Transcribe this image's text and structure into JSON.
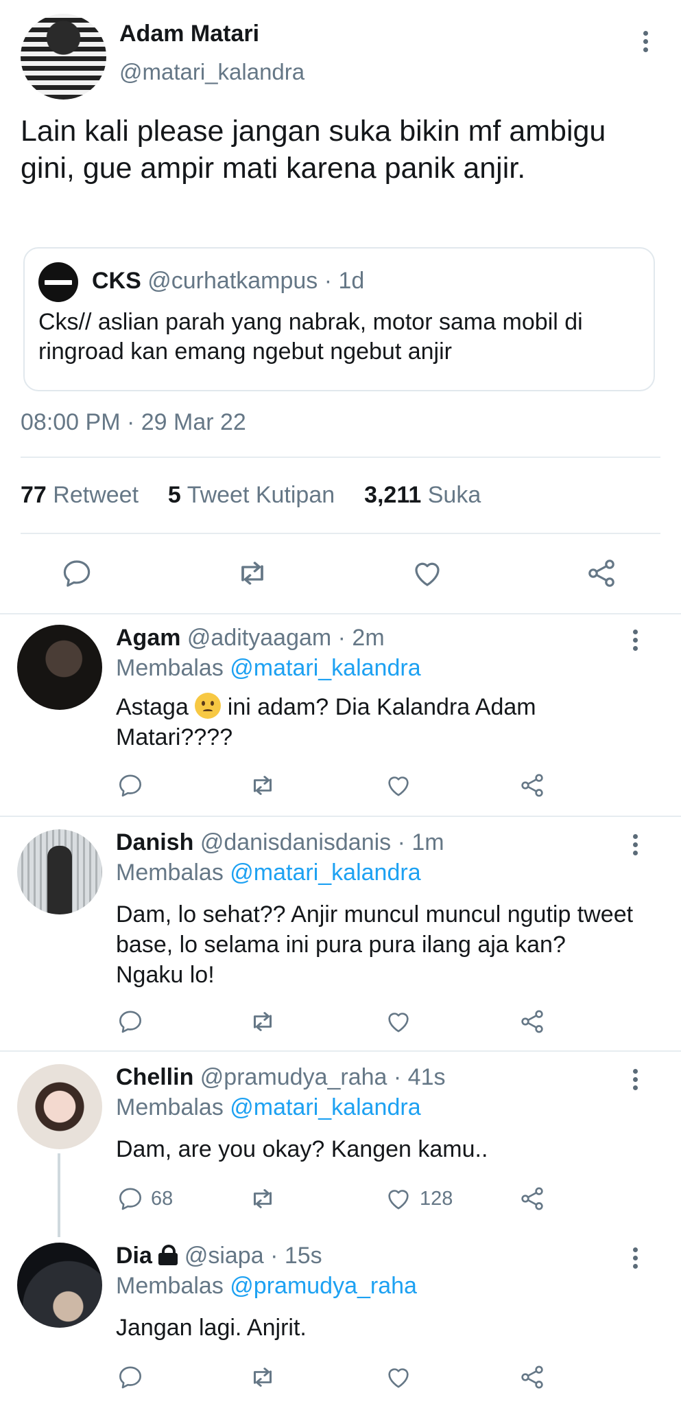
{
  "main_tweet": {
    "author_name": "Adam Matari",
    "author_handle": "@matari_kalandra",
    "text": "Lain kali please jangan suka bikin mf ambigu gini, gue ampir mati karena panik anjir.",
    "quoted": {
      "name": "CKS",
      "meta": "@curhatkampus · 1d",
      "text": "Cks// aslian parah yang nabrak, motor sama mobil di ringroad kan emang ngebut ngebut anjir"
    },
    "timestamp": "08:00 PM · 29 Mar 22",
    "stats": {
      "retweets_count": "77",
      "retweets_label": "Retweet",
      "quotes_count": "5",
      "quotes_label": "Tweet Kutipan",
      "likes_count": "3,211",
      "likes_label": "Suka"
    }
  },
  "replying_label": "Membalas",
  "replies": [
    {
      "name": "Agam",
      "meta": "@adityaagam · 2m",
      "reply_to": "@matari_kalandra",
      "text_before": "Astaga",
      "emoji": "😟",
      "text_after": "ini adam? Dia Kalandra Adam Matari????",
      "reply_count": "",
      "like_count": ""
    },
    {
      "name": "Danish",
      "meta": "@danisdanisdanis · 1m",
      "reply_to": "@matari_kalandra",
      "text": "Dam, lo sehat?? Anjir muncul muncul ngutip tweet base, lo selama ini pura pura ilang aja kan? Ngaku lo!",
      "reply_count": "",
      "like_count": ""
    },
    {
      "name": "Chellin",
      "meta": "@pramudya_raha · 41s",
      "reply_to": "@matari_kalandra",
      "text": "Dam, are you okay? Kangen kamu..",
      "reply_count": "68",
      "like_count": "128"
    },
    {
      "name": "Dia",
      "meta": "@siapa · 15s",
      "reply_to": "@pramudya_raha",
      "text": "Jangan lagi. Anjrit.",
      "reply_count": "",
      "like_count": ""
    }
  ],
  "colors": {
    "accent": "#1da1f2",
    "text": "#14171a",
    "muted": "#657786",
    "divider": "#e6ecf0"
  }
}
